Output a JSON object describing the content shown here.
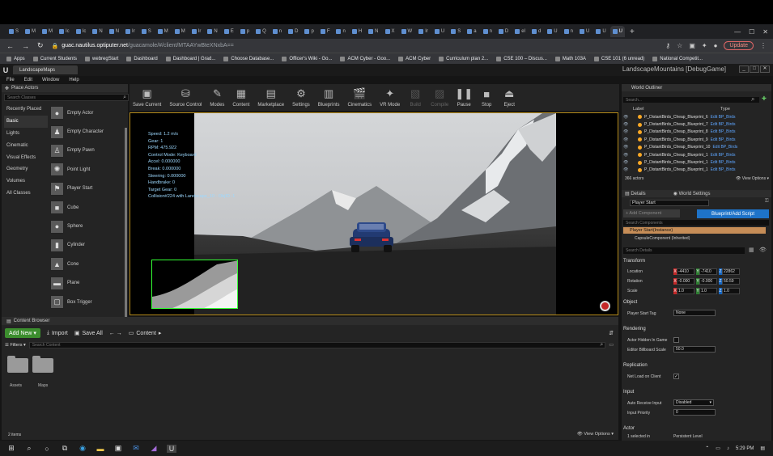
{
  "browser": {
    "tabs": [
      "S",
      "M",
      "M",
      "Ic",
      "Ic",
      "N",
      "N",
      "Ir",
      "S",
      "M",
      "M",
      "Ir",
      "N",
      "E",
      "p",
      "Q",
      "n",
      "D",
      "p",
      "F",
      "n",
      "H",
      "N",
      "X",
      "W",
      "Ir",
      "U",
      "S",
      "a",
      "n",
      "D",
      "el",
      "d",
      "U",
      "n",
      "U",
      "U",
      "U"
    ],
    "new_tab": "+",
    "url_host": "guac.nautilus.optiputer.net",
    "url_path": "/guacamole/#/client/MTAAYwBteXNxbA==",
    "update_label": "Update",
    "bookmarks": [
      "Apps",
      "Current Students",
      "webregStart",
      "Dashboard",
      "Dashboard | Grad...",
      "Choose Database...",
      "Officer's Wiki - Go...",
      "ACM Cyber - Goo...",
      "ACM Cyber",
      "Curriculum plan 2...",
      "CSE 100 – Discus...",
      "Math 103A",
      "CSE 101 (6 unread)",
      "National Competit..."
    ]
  },
  "editor": {
    "map_tab": "LandscapeMaps",
    "game_title": "LandscapeMountains [DebugGame]",
    "menu": [
      "File",
      "Edit",
      "Window",
      "Help"
    ],
    "toolbar": [
      {
        "label": "Save Current",
        "icon": "save-icon",
        "glyph": "▣"
      },
      {
        "label": "Source Control",
        "icon": "source-control-icon",
        "glyph": "⛁"
      },
      {
        "label": "Modes",
        "icon": "modes-icon",
        "glyph": "✎"
      },
      {
        "label": "Content",
        "icon": "content-icon",
        "glyph": "▦"
      },
      {
        "label": "Marketplace",
        "icon": "marketplace-icon",
        "glyph": "▤"
      },
      {
        "label": "Settings",
        "icon": "settings-icon",
        "glyph": "⚙"
      },
      {
        "label": "Blueprints",
        "icon": "blueprints-icon",
        "glyph": "▥"
      },
      {
        "label": "Cinematics",
        "icon": "cinematics-icon",
        "glyph": "🎬"
      },
      {
        "label": "VR Mode",
        "icon": "vr-mode-icon",
        "glyph": "✦"
      },
      {
        "label": "Build",
        "icon": "build-icon",
        "glyph": "▧"
      },
      {
        "label": "Compile",
        "icon": "compile-icon",
        "glyph": "▨"
      },
      {
        "label": "Pause",
        "icon": "pause-icon",
        "glyph": "❚❚"
      },
      {
        "label": "Stop",
        "icon": "stop-icon",
        "glyph": "■"
      },
      {
        "label": "Eject",
        "icon": "eject-icon",
        "glyph": "⏏"
      }
    ],
    "place_actors": {
      "title": "Place Actors",
      "search_placeholder": "Search Classes",
      "categories": [
        "Recently Placed",
        "Basic",
        "Lights",
        "Cinematic",
        "Visual Effects",
        "Geometry",
        "Volumes",
        "All Classes"
      ],
      "selected_category": "Basic",
      "items": [
        {
          "label": "Empty Actor",
          "glyph": "●"
        },
        {
          "label": "Empty Character",
          "glyph": "♟"
        },
        {
          "label": "Empty Pawn",
          "glyph": "♙"
        },
        {
          "label": "Point Light",
          "glyph": "✺"
        },
        {
          "label": "Player Start",
          "glyph": "⚑"
        },
        {
          "label": "Cube",
          "glyph": "■"
        },
        {
          "label": "Sphere",
          "glyph": "●"
        },
        {
          "label": "Cylinder",
          "glyph": "▮"
        },
        {
          "label": "Cone",
          "glyph": "▲"
        },
        {
          "label": "Plane",
          "glyph": "▬"
        },
        {
          "label": "Box Trigger",
          "glyph": "▢"
        }
      ]
    },
    "hud": [
      "Speed: 1.2 m/s",
      "Gear: 1",
      "RPM: 475.922",
      "Control Mode: Keyboard",
      "Accel: 0.000000",
      "Break: 0.000000",
      "Steering: 0.000000",
      "Handbrake: 0",
      "Target Gear: 0",
      "Collision#224 with Landscape_10 - ObjID -1"
    ],
    "content_browser": {
      "title": "Content Browser",
      "add_new": "Add New",
      "import": "Import",
      "save_all": "Save All",
      "path": "Content",
      "filters": "Filters",
      "search_placeholder": "Search Content",
      "folders": [
        "Assets",
        "Maps"
      ],
      "items_count": "2 items",
      "view_options": "View Options"
    },
    "world_outliner": {
      "title": "World Outliner",
      "search_placeholder": "Search...",
      "col_label": "Label",
      "col_type": "Type",
      "rows": [
        {
          "label": "P_DistantBirds_Cheap_Blueprint_6",
          "type": "Edit BP_Birds"
        },
        {
          "label": "P_DistantBirds_Cheap_Blueprint_7",
          "type": "Edit BP_Birds"
        },
        {
          "label": "P_DistantBirds_Cheap_Blueprint_8",
          "type": "Edit BP_Birds"
        },
        {
          "label": "P_DistantBirds_Cheap_Blueprint_9",
          "type": "Edit BP_Birds"
        },
        {
          "label": "P_DistantBirds_Cheap_Blueprint_10",
          "type": "Edit BP_Birds"
        },
        {
          "label": "P_DistantBirds_Cheap_Blueprint_1",
          "type": "Edit BP_Birds"
        },
        {
          "label": "P_DistantBirds_Cheap_Blueprint_1",
          "type": "Edit BP_Birds"
        },
        {
          "label": "P_DistantBirds_Cheap_Blueprint_1",
          "type": "Edit BP_Birds"
        }
      ],
      "actor_count": "366 actors",
      "view_options": "View Options"
    },
    "details": {
      "tab_details": "Details",
      "tab_world": "World Settings",
      "name_value": "Player Start",
      "add_component": "+ Add Component",
      "blueprint_btn": "Blueprint/Add Script",
      "comp_search": "Search Components",
      "comp_selected": "Player Start(Instance)",
      "comp_child": "CapsuleComponent (Inherited)",
      "details_search": "Search Details",
      "transform": "Transform",
      "location_label": "Location",
      "location": [
        "-4410",
        "-7410",
        "22862"
      ],
      "rotation_label": "Rotation",
      "rotation": [
        "-0.000",
        "-0.000",
        "50.59"
      ],
      "scale_label": "Scale",
      "scale": [
        "1.0",
        "1.0",
        "1.0"
      ],
      "object": "Object",
      "player_start_tag_label": "Player Start Tag",
      "player_start_tag": "None",
      "rendering": "Rendering",
      "actor_hidden_label": "Actor Hidden In Game",
      "billboard_label": "Editor Billboard Scale",
      "billboard_value": "50.0",
      "replication": "Replication",
      "net_load_label": "Net Load on Client",
      "input": "Input",
      "auto_receive_label": "Auto Receive Input",
      "auto_receive_value": "Disabled",
      "input_priority_label": "Input Priority",
      "input_priority_value": "0",
      "actor": "Actor",
      "selected_in": "1 selected in",
      "level": "Persistent Level"
    }
  },
  "taskbar": {
    "time": "5:29 PM"
  }
}
